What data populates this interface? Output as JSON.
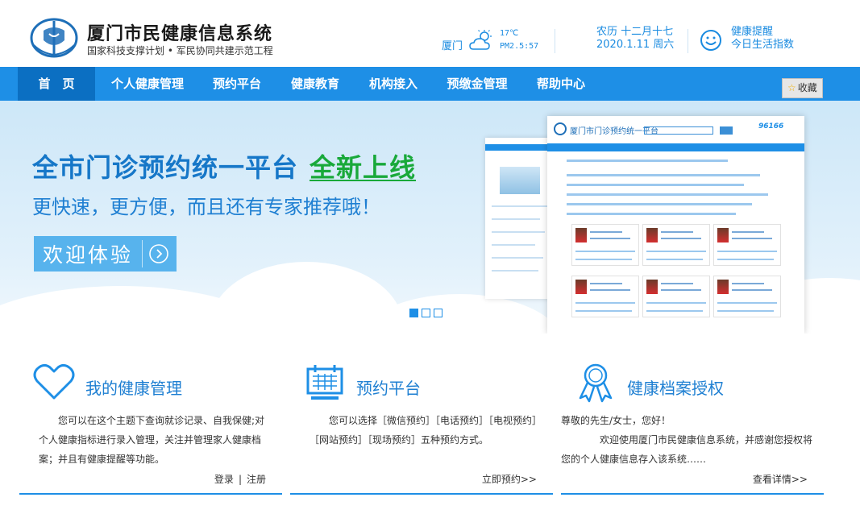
{
  "header": {
    "site_title": "厦门市民健康信息系统",
    "site_subtitle": "国家科技支撑计划 • 军民协同共建示范工程",
    "weather": {
      "city": "厦门",
      "temperature": "17℃",
      "pm25": "PM2.5:57",
      "icon": "cloud-sun-icon"
    },
    "lunar_date": "农历 十二月十七",
    "solar_date": "2020.1.11 周六",
    "reminder_line1": "健康提醒",
    "reminder_line2": "今日生活指数"
  },
  "nav": {
    "items": [
      {
        "label": "首　页",
        "active": true
      },
      {
        "label": "个人健康管理"
      },
      {
        "label": "预约平台"
      },
      {
        "label": "健康教育"
      },
      {
        "label": "机构接入"
      },
      {
        "label": "预缴金管理"
      },
      {
        "label": "帮助中心"
      }
    ],
    "favorite_label": "收藏"
  },
  "banner": {
    "headline": "全市门诊预约统一平台",
    "headline_highlight": "全新上线",
    "subline": "更快速，更方便，而且还有专家推荐哦！",
    "cta_label": "欢迎体验",
    "mock_title": "厦门市门诊预约统一平台",
    "mock_phone": "96166",
    "slide_count": 3,
    "active_slide": 1
  },
  "features": [
    {
      "title": "我的健康管理",
      "icon": "heart-icon",
      "body": "您可以在这个主题下查询就诊记录、自我保健;对个人健康指标进行录入管理，关注并管理家人健康档案；并且有健康提醒等功能。",
      "link1": "登录",
      "link2": "注册"
    },
    {
      "title": "预约平台",
      "icon": "calendar-icon",
      "body": "您可以选择［微信预约］［电话预约］［电视预约］［网站预约］［现场预约］五种预约方式。",
      "link1": "立即预约>>"
    },
    {
      "title": "健康档案授权",
      "icon": "award-ribbon-icon",
      "greeting": "尊敬的先生/女士，您好！",
      "body": "欢迎使用厦门市民健康信息系统，并感谢您授权将您的个人健康信息存入该系统……",
      "link1": "查看详情>>"
    }
  ],
  "colors": {
    "brand_blue": "#1e8fe6",
    "nav_active": "#0b6fc2",
    "highlight_green": "#19a93a"
  }
}
